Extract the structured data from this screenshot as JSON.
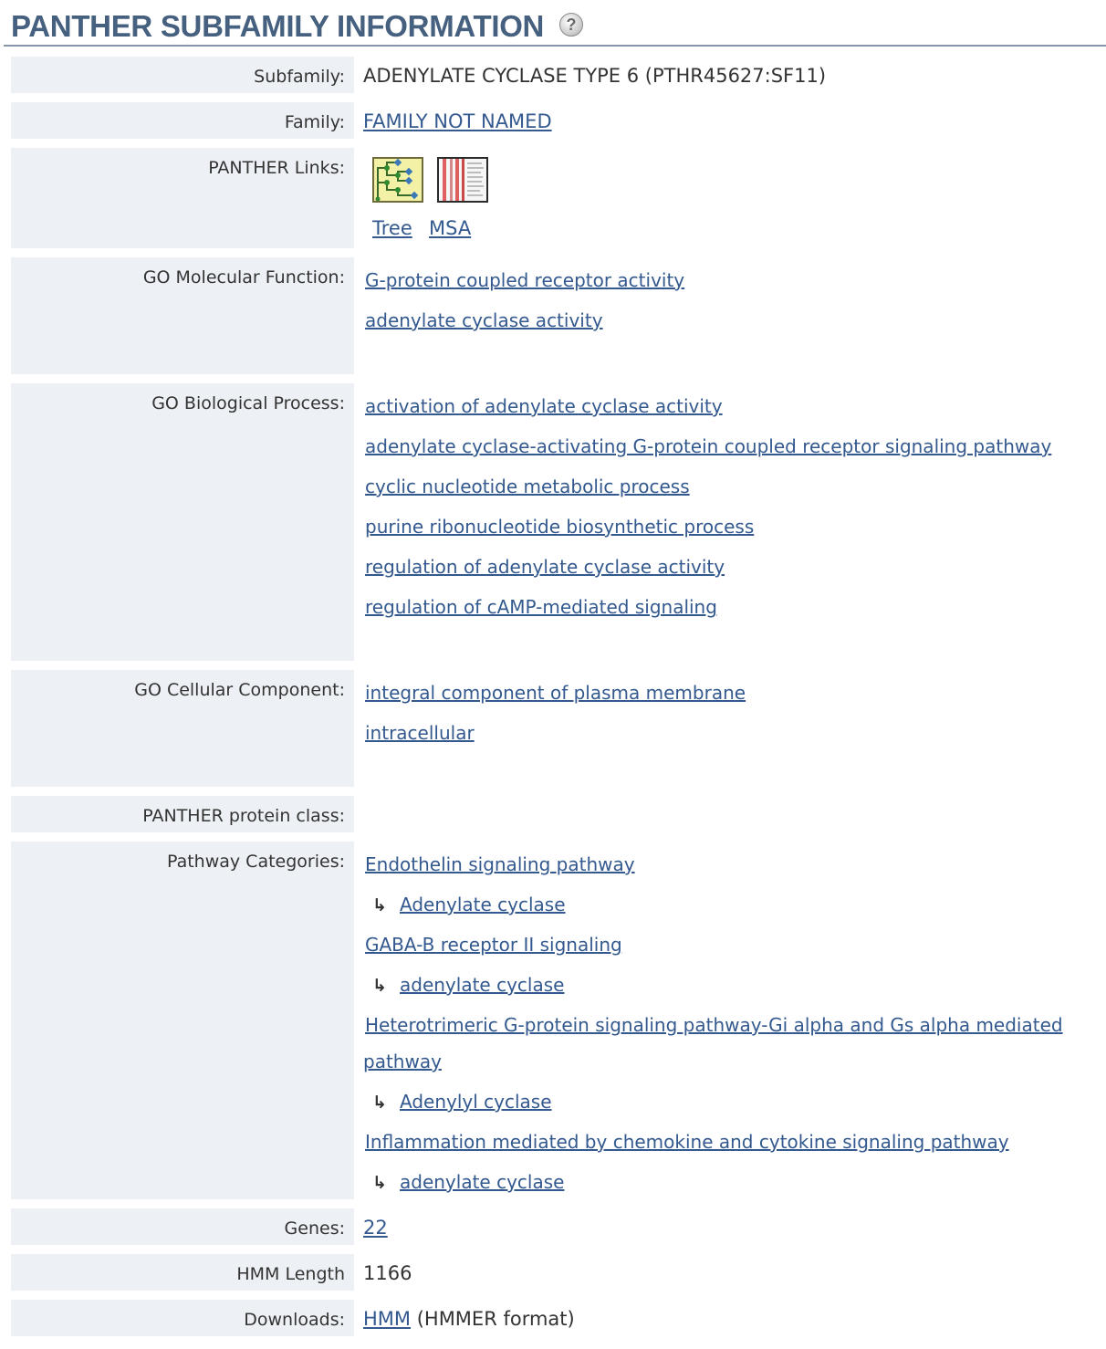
{
  "header": {
    "title": "PANTHER SUBFAMILY INFORMATION",
    "help_glyph": "?"
  },
  "labels": {
    "subfamily": "Subfamily:",
    "family": "Family:",
    "panther_links": "PANTHER Links:",
    "go_mf": "GO Molecular Function:",
    "go_bp": "GO Biological Process:",
    "go_cc": "GO Cellular Component:",
    "protein_class": "PANTHER protein class:",
    "pathways": "Pathway Categories:",
    "genes": "Genes:",
    "hmm_length": "HMM Length",
    "downloads": "Downloads:"
  },
  "subfamily": "ADENYLATE CYCLASE TYPE 6 (PTHR45627:SF11)",
  "family": "FAMILY NOT NAMED",
  "panther_links": {
    "tree_label": "Tree",
    "msa_label": "MSA",
    "tree_icon": "tree-icon",
    "msa_icon": "msa-icon"
  },
  "go_molecular_function": [
    "G-protein coupled receptor activity",
    "adenylate cyclase activity"
  ],
  "go_biological_process": [
    "activation of adenylate cyclase activity",
    "adenylate cyclase-activating G-protein coupled receptor signaling pathway",
    "cyclic nucleotide metabolic process",
    "purine ribonucleotide biosynthetic process",
    "regulation of adenylate cyclase activity",
    "regulation of cAMP-mediated signaling"
  ],
  "go_cellular_component": [
    "integral component of plasma membrane",
    "intracellular"
  ],
  "pathways": [
    {
      "name": "Endothelin signaling pathway",
      "component": "Adenylate cyclase"
    },
    {
      "name": "GABA-B receptor II signaling",
      "component": "adenylate cyclase"
    },
    {
      "name_line1": "Heterotrimeric G-protein signaling pathway-Gi alpha and Gs alpha mediated",
      "name_line2": "pathway",
      "component": "Adenylyl cyclase"
    },
    {
      "name": "Inflammation mediated by chemokine and cytokine signaling pathway",
      "component": "adenylate cyclase"
    }
  ],
  "arrow_glyph": "↳",
  "genes": "22",
  "hmm_length": "1166",
  "downloads": {
    "link": "HMM",
    "suffix": " (HMMER format)"
  },
  "colors": {
    "title": "#46607f",
    "link": "#33598f",
    "label_bg": "#edf1f5",
    "text": "#333333"
  }
}
